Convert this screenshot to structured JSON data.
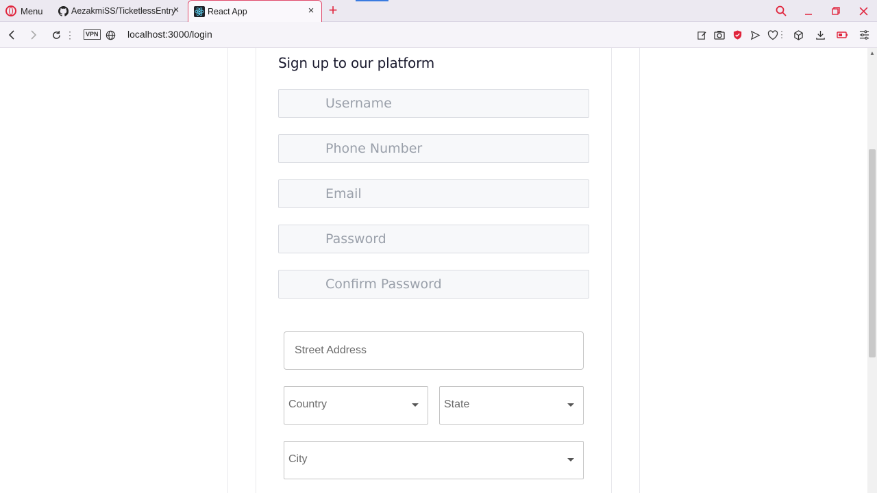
{
  "browser": {
    "menu_label": "Menu",
    "tabs": [
      {
        "title": "AezakmiSS/TicketlessEntry",
        "icon": "github-icon"
      },
      {
        "title": "React App",
        "icon": "react-icon"
      }
    ],
    "new_tab_symbol": "+",
    "vpn_label": "VPN",
    "url": "localhost:3000/login",
    "accent_color": "#e0243c"
  },
  "form": {
    "title": "Sign up to our platform",
    "fields": {
      "username": "Username",
      "phone": "Phone Number",
      "email": "Email",
      "password": "Password",
      "confirm_password": "Confirm Password"
    },
    "address": {
      "street": "Street Address",
      "country": "Country",
      "state": "State",
      "city": "City"
    }
  }
}
